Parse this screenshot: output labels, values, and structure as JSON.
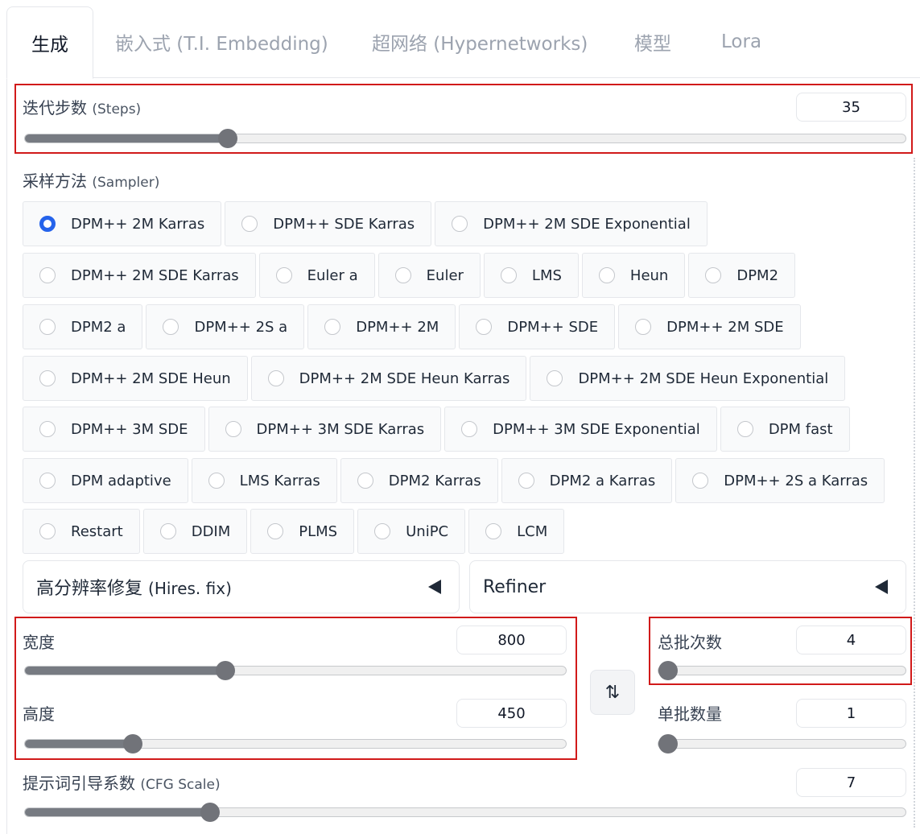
{
  "tabs": [
    {
      "label": "生成",
      "active": true
    },
    {
      "label": "嵌入式 (T.I. Embedding)"
    },
    {
      "label": "超网络 (Hypernetworks)"
    },
    {
      "label": "模型"
    },
    {
      "label": "Lora"
    }
  ],
  "steps": {
    "label_zh": "迭代步数",
    "label_en": "(Steps)",
    "value": "35",
    "slider_fraction": 0.23
  },
  "sampler": {
    "label_zh": "采样方法",
    "label_en": "(Sampler)",
    "selected": "DPM++ 2M Karras",
    "rows": [
      [
        "DPM++ 2M Karras",
        "DPM++ SDE Karras",
        "DPM++ 2M SDE Exponential"
      ],
      [
        "DPM++ 2M SDE Karras",
        "Euler a",
        "Euler",
        "LMS",
        "Heun",
        "DPM2"
      ],
      [
        "DPM2 a",
        "DPM++ 2S a",
        "DPM++ 2M",
        "DPM++ SDE",
        "DPM++ 2M SDE"
      ],
      [
        "DPM++ 2M SDE Heun",
        "DPM++ 2M SDE Heun Karras",
        "DPM++ 2M SDE Heun Exponential"
      ],
      [
        "DPM++ 3M SDE",
        "DPM++ 3M SDE Karras",
        "DPM++ 3M SDE Exponential",
        "DPM fast"
      ],
      [
        "DPM adaptive",
        "LMS Karras",
        "DPM2 Karras",
        "DPM2 a Karras",
        "DPM++ 2S a Karras"
      ],
      [
        "Restart",
        "DDIM",
        "PLMS",
        "UniPC",
        "LCM"
      ]
    ]
  },
  "hires": {
    "label_zh": "高分辨率修复",
    "label_en": "(Hires. fix)"
  },
  "refiner": {
    "label": "Refiner"
  },
  "width": {
    "label": "宽度",
    "value": "800",
    "slider_fraction": 0.37
  },
  "height": {
    "label": "高度",
    "value": "450",
    "slider_fraction": 0.2
  },
  "swap": {
    "icon": "⇅"
  },
  "batch_count": {
    "label": "总批次数",
    "value": "4",
    "slider_fraction": 0.03
  },
  "batch_size": {
    "label": "单批数量",
    "value": "1",
    "slider_fraction": 0.0
  },
  "cfg": {
    "label_zh": "提示词引导系数",
    "label_en": "(CFG Scale)",
    "value": "7",
    "slider_fraction": 0.21
  },
  "colors": {
    "accent": "#2563eb",
    "highlight": "#d11a1a"
  }
}
